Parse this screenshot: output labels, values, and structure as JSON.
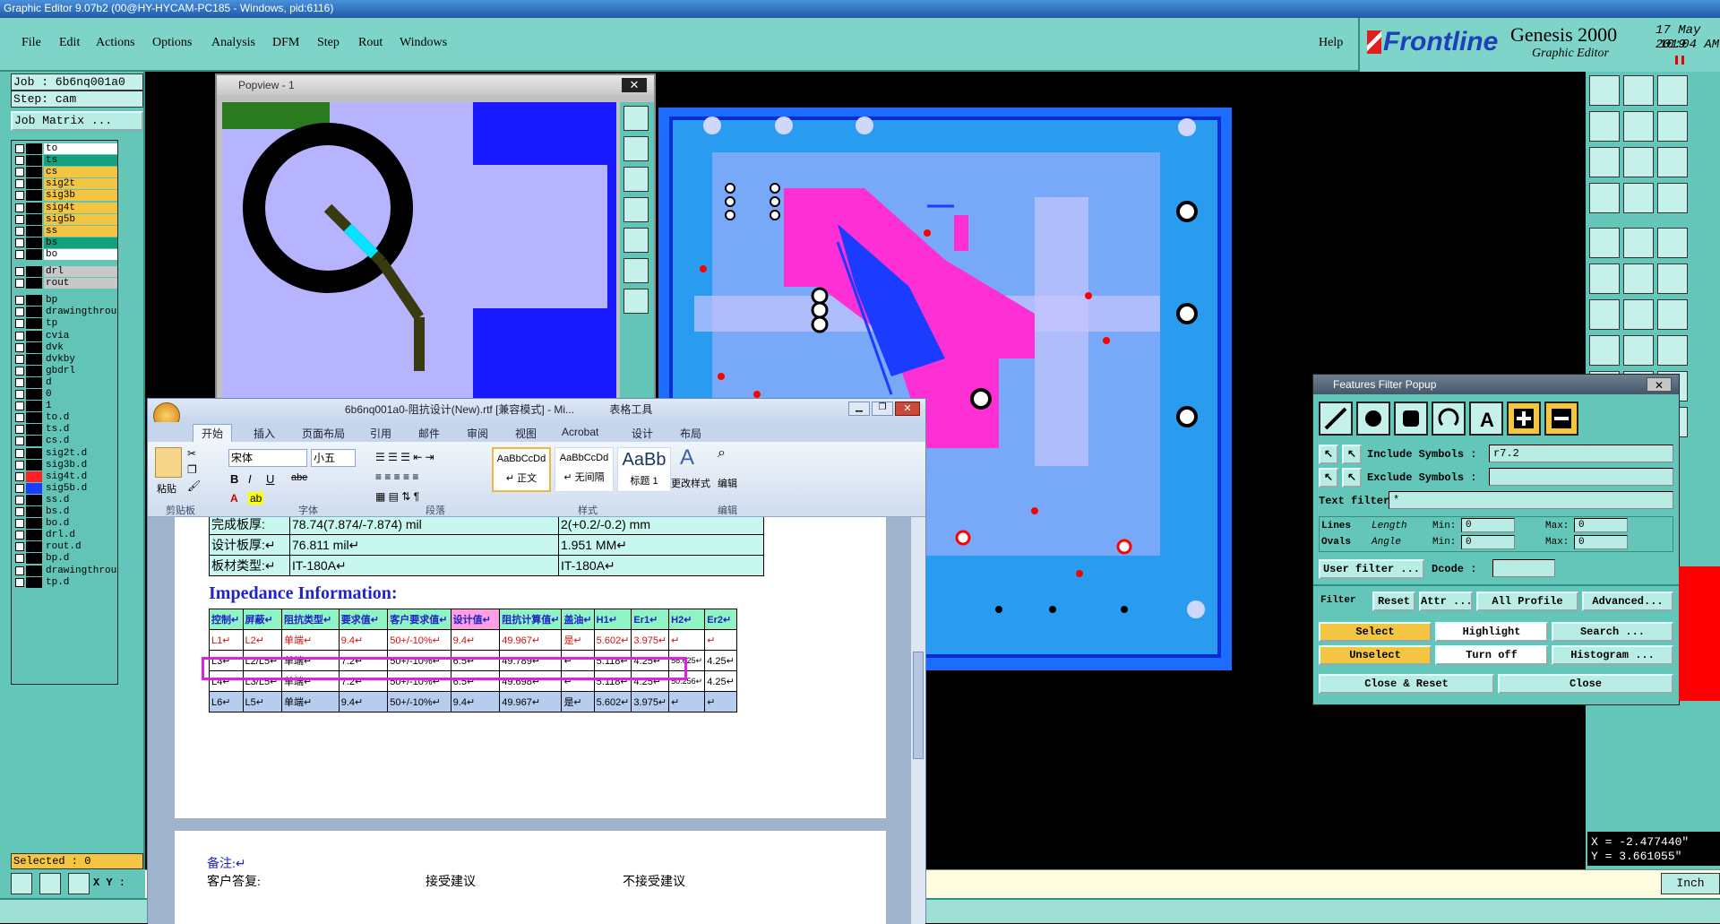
{
  "window": {
    "title": "Graphic Editor 9.07b2 (00@HY-HYCAM-PC185 - Windows, pid:6116)"
  },
  "menu": {
    "items": [
      "File",
      "Edit",
      "Actions",
      "Options",
      "Analysis",
      "DFM",
      "Step",
      "Rout",
      "Windows"
    ],
    "help": "Help"
  },
  "brand": {
    "logo": "Frontline",
    "product": "Genesis 2000",
    "subtitle": "Graphic Editor",
    "date": "17 May 2019",
    "time": "10:04 AM"
  },
  "job": {
    "job_label": "Job : 6b6nq001a0",
    "step_label": "Step: cam",
    "matrix_button": "Job Matrix ..."
  },
  "layers": [
    {
      "name": "to",
      "color": "#ffffff"
    },
    {
      "name": "ts",
      "color": "#13a07d"
    },
    {
      "name": "cs",
      "color": "#f4c542"
    },
    {
      "name": "sig2t",
      "color": "#f4c542"
    },
    {
      "name": "sig3b",
      "color": "#f4c542"
    },
    {
      "name": "sig4t",
      "color": "#f4c542"
    },
    {
      "name": "sig5b",
      "color": "#f4c542"
    },
    {
      "name": "ss",
      "color": "#f4c542"
    },
    {
      "name": "bs",
      "color": "#13a07d"
    },
    {
      "name": "bo",
      "color": "#ffffff"
    },
    {
      "name": "drl",
      "color": "#c8c8c8"
    },
    {
      "name": "rout",
      "color": "#c8c8c8"
    },
    {
      "name": "bp",
      "color": "#62c4b6"
    },
    {
      "name": "drawingthrou",
      "color": "#62c4b6"
    },
    {
      "name": "tp",
      "color": "#62c4b6"
    },
    {
      "name": "cvia",
      "color": "#62c4b6"
    },
    {
      "name": "dvk",
      "color": "#62c4b6"
    },
    {
      "name": "dvkby",
      "color": "#62c4b6"
    },
    {
      "name": "gbdrl",
      "color": "#62c4b6"
    },
    {
      "name": "d",
      "color": "#62c4b6"
    },
    {
      "name": "0",
      "color": "#62c4b6"
    },
    {
      "name": "1",
      "color": "#62c4b6"
    },
    {
      "name": "to.d",
      "color": "#62c4b6"
    },
    {
      "name": "ts.d",
      "color": "#62c4b6"
    },
    {
      "name": "cs.d",
      "color": "#62c4b6"
    },
    {
      "name": "sig2t.d",
      "color": "#62c4b6"
    },
    {
      "name": "sig3b.d",
      "color": "#62c4b6"
    },
    {
      "name": "sig4t.d",
      "color": "#62c4b6"
    },
    {
      "name": "sig5b.d",
      "color": "#62c4b6"
    },
    {
      "name": "ss.d",
      "color": "#62c4b6"
    },
    {
      "name": "bs.d",
      "color": "#62c4b6"
    },
    {
      "name": "bo.d",
      "color": "#62c4b6"
    },
    {
      "name": "drl.d",
      "color": "#62c4b6"
    },
    {
      "name": "rout.d",
      "color": "#62c4b6"
    },
    {
      "name": "bp.d",
      "color": "#62c4b6"
    },
    {
      "name": "drawingthrou",
      "color": "#62c4b6"
    },
    {
      "name": "tp.d",
      "color": "#62c4b6"
    }
  ],
  "selected": "Selected : 0",
  "xy_label": "X Y :",
  "popview": {
    "title": "Popview - 1"
  },
  "features_filter": {
    "title": "Features Filter Popup",
    "include_label": "Include Symbols :",
    "include_value": "r7.2",
    "exclude_label": "Exclude Symbols :",
    "text_filter_label": "Text filter",
    "text_filter_value": "*",
    "lines": "Lines",
    "ovals": "Ovals",
    "length": "Length",
    "angle": "Angle",
    "min": "Min:",
    "max": "Max:",
    "zero": "0",
    "user_filter": "User filter ...",
    "dcode": "Dcode :",
    "filter": "Filter",
    "reset": "Reset",
    "attr": "Attr ...",
    "all_profile": "All Profile",
    "advanced": "Advanced...",
    "select": "Select",
    "highlight": "Highlight",
    "search": "Search ...",
    "unselect": "Unselect",
    "turn_off": "Turn off",
    "histogram": "Histogram ...",
    "close_reset": "Close & Reset",
    "close": "Close"
  },
  "coords": {
    "x": "X = -2.477440\"",
    "y": "Y = 3.661055\""
  },
  "unit": "Inch",
  "word": {
    "title": "6b6nq001a0-阻抗设计(New).rtf [兼容模式] - Mi...",
    "table_tools": "表格工具",
    "tabs": [
      "开始",
      "插入",
      "页面布局",
      "引用",
      "邮件",
      "审阅",
      "视图",
      "Acrobat",
      "设计",
      "布局"
    ],
    "font_name": "宋体",
    "font_size": "小五",
    "groups": [
      "剪贴板",
      "字体",
      "段落",
      "样式",
      "编辑"
    ],
    "paste": "粘贴",
    "styles": [
      {
        "preview": "AaBbCcDd",
        "name": "↵ 正文"
      },
      {
        "preview": "AaBbCcDd",
        "name": "↵ 无间隔"
      },
      {
        "preview": "AaBb",
        "name": "标题 1"
      }
    ],
    "change_styles": "更改样式",
    "edit": "编辑",
    "info_rows": [
      [
        "完成板厚:",
        "78.74(7.874/-7.874) mil",
        "2(+0.2/-0.2) mm"
      ],
      [
        "设计板厚:↵",
        "76.811 mil↵",
        "1.951 MM↵"
      ],
      [
        "板材类型:↵",
        "IT-180A↵",
        "IT-180A↵"
      ]
    ],
    "impedance_title": "Impedance Information:",
    "imp_headers": [
      "控制↵",
      "屏蔽↵",
      "阻抗类型↵",
      "要求值↵",
      "客户要求值↵",
      "设计值↵",
      "阻抗计算值↵",
      "盖油↵",
      "H1↵",
      "Er1↵",
      "H2↵",
      "Er2↵"
    ],
    "imp_rows": [
      [
        "L1↵",
        "L2↵",
        "单端↵",
        "9.4↵",
        "50+/-10%↵",
        "9.4↵",
        "49.967↵",
        "是↵",
        "5.602↵",
        "3.975↵",
        "↵",
        "↵"
      ],
      [
        "L3↵",
        "L2/L5↵",
        "单端↵",
        "7.2↵",
        "50+/-10%↵",
        "6.5↵",
        "49.789↵",
        "↵",
        "5.118↵",
        "4.25↵",
        "56.625↵",
        "4.25↵"
      ],
      [
        "L4↵",
        "L3/L5↵",
        "单端↵",
        "7.2↵",
        "50+/-10%↵",
        "6.5↵",
        "49.698↵",
        "↵",
        "5.118↵",
        "4.25↵",
        "50.256↵",
        "4.25↵"
      ],
      [
        "L6↵",
        "L5↵",
        "单端↵",
        "9.4↵",
        "50+/-10%↵",
        "9.4↵",
        "49.967↵",
        "是↵",
        "5.602↵",
        "3.975↵",
        "↵",
        "↵"
      ]
    ],
    "notes": "备注:↵",
    "reply_customer": "客户答复:",
    "accept": "接受建议",
    "reject": "不接受建议"
  },
  "colors": {
    "accent": "#63c6b8",
    "pcb_fill": "#1b6cff",
    "magenta": "#ff2fd6",
    "highlight_box": "#e020e0"
  }
}
